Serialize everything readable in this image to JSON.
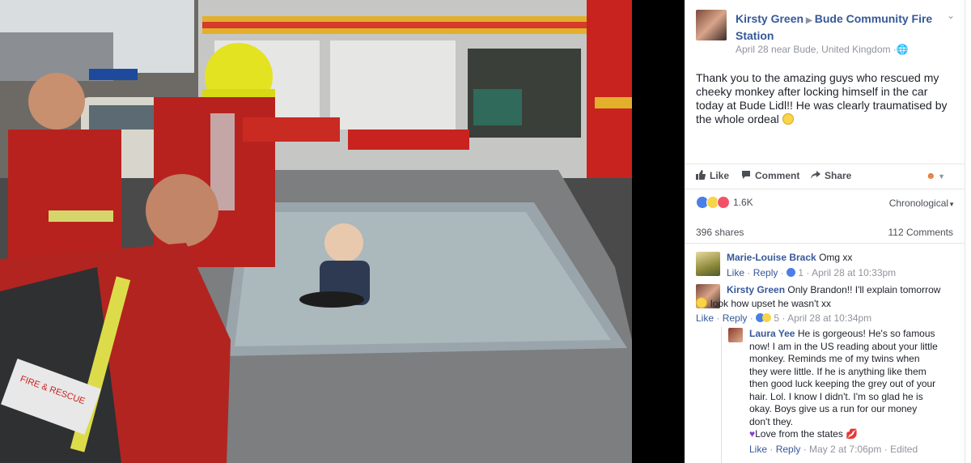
{
  "post": {
    "author": "Kirsty Green",
    "target": "Bude Community Fire Station",
    "date": "April 28",
    "location_prefix": "near",
    "location": "Bude, United Kingdom",
    "privacy_icon": "globe-icon",
    "text": "Thank you to the amazing guys who rescued my cheeky monkey after locking himself in the car today at Bude Lidl!! He was clearly traumatised by the whole ordeal"
  },
  "actions": {
    "like": "Like",
    "comment": "Comment",
    "share": "Share"
  },
  "reactions": {
    "count": "1.6K",
    "sort": "Chronological"
  },
  "stats": {
    "shares": "396 shares",
    "comments": "112 Comments"
  },
  "comments": [
    {
      "name": "Marie-Louise Brack",
      "text": "Omg xx",
      "like": "Like",
      "reply": "Reply",
      "reaction_count": "1",
      "time": "April 28 at 10:33pm"
    },
    {
      "name": "Kirsty Green",
      "text": "Only Brandon!! I'll explain tomorrow",
      "text2": "look how upset he wasn't xx",
      "like": "Like",
      "reply": "Reply",
      "reaction_count": "5",
      "time": "April 28 at 10:34pm"
    }
  ],
  "reply": {
    "name": "Laura Yee",
    "lines": [
      "He is gorgeous! He's so famous",
      "now! I am in the US reading about your little",
      "monkey. Reminds me of my twins when",
      "they were little. If he is anything like them",
      "then good luck keeping the grey out of your",
      "hair. Lol. I know I didn't. I'm so glad he is",
      "okay. Boys give us a run for our money",
      "don't they."
    ],
    "closing": "Love from the states",
    "like": "Like",
    "reply": "Reply",
    "time": "May 2 at 7:06pm",
    "edited": "Edited"
  },
  "colors": {
    "link": "#365899",
    "meta": "#90949c",
    "like_blue": "#4c7ee8",
    "love_red": "#f25268"
  }
}
